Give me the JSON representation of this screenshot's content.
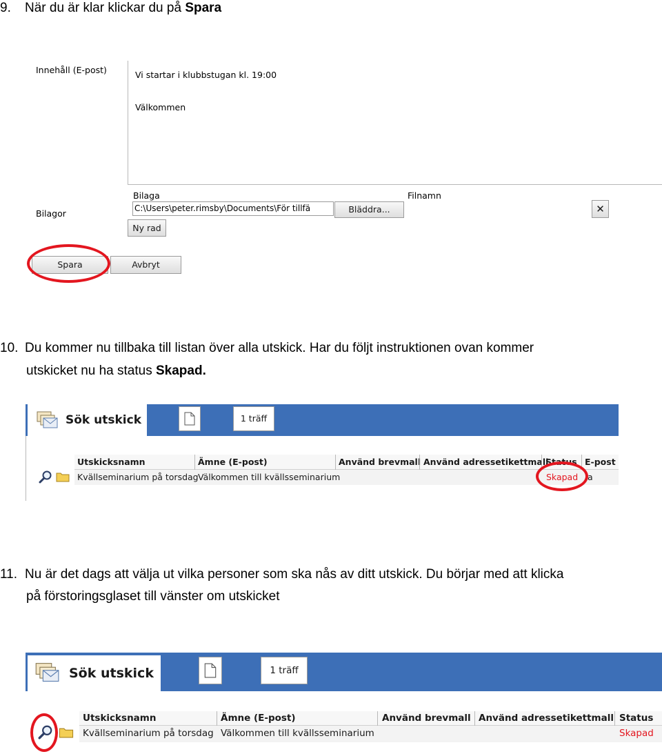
{
  "steps": [
    {
      "number": "9.",
      "text_before": "När du är klar klickar du på ",
      "text_bold": "Spara",
      "text_after": "",
      "line2": "",
      "line2_bold": ""
    },
    {
      "number": "10.",
      "text_before": "Du kommer nu tillbaka till listan över alla utskick. Har du följt instruktionen ovan kommer",
      "text_bold": "",
      "text_after": "",
      "line2": "utskicket nu ha status ",
      "line2_bold": "Skapad."
    },
    {
      "number": "11.",
      "text_before": "Nu är det dags att välja ut vilka personer som ska nås av ditt utskick. Du börjar med att klicka",
      "text_bold": "",
      "text_after": "",
      "line2": "på förstoringsglaset till vänster om utskicket",
      "line2_bold": ""
    }
  ],
  "form": {
    "content_label": "Innehåll (E-post)",
    "content_line1": "Vi startar i klubbstugan kl. 19:00",
    "content_line2": "Välkommen",
    "attachments_label": "Bilagor",
    "attachment_col_label": "Bilaga",
    "filename_col_label": "Filnamn",
    "file_path_value": "C:\\Users\\peter.rimsby\\Documents\\För tillfä",
    "browse_button": "Bläddra...",
    "remove_button": "✕",
    "new_row_button": "Ny rad",
    "save_button": "Spara",
    "cancel_button": "Avbryt"
  },
  "list_panel_1": {
    "title": "Sök utskick",
    "hits": "1 träff",
    "columns": [
      "Utskicksnamn",
      "Ämne (E-post)",
      "Använd brevmall",
      "Använd adressetikettmall",
      "Status",
      "E-post"
    ],
    "row": {
      "name": "Kvällseminarium på torsdag",
      "subject": "Välkommen till kvällsseminarium",
      "template": "",
      "label_template": "",
      "status": "Skapad",
      "email": "a"
    }
  },
  "list_panel_2": {
    "title": "Sök utskick",
    "hits": "1 träff",
    "columns": [
      "Utskicksnamn",
      "Ämne (E-post)",
      "Använd brevmall",
      "Använd adressetikettmall",
      "Status"
    ],
    "row": {
      "name": "Kvällseminarium på torsdag",
      "subject": "Välkommen till kvällsseminarium",
      "template": "",
      "label_template": "",
      "status": "Skapad"
    }
  },
  "colors": {
    "header_blue": "#3d6fb7",
    "highlight_red": "#e3161f"
  }
}
